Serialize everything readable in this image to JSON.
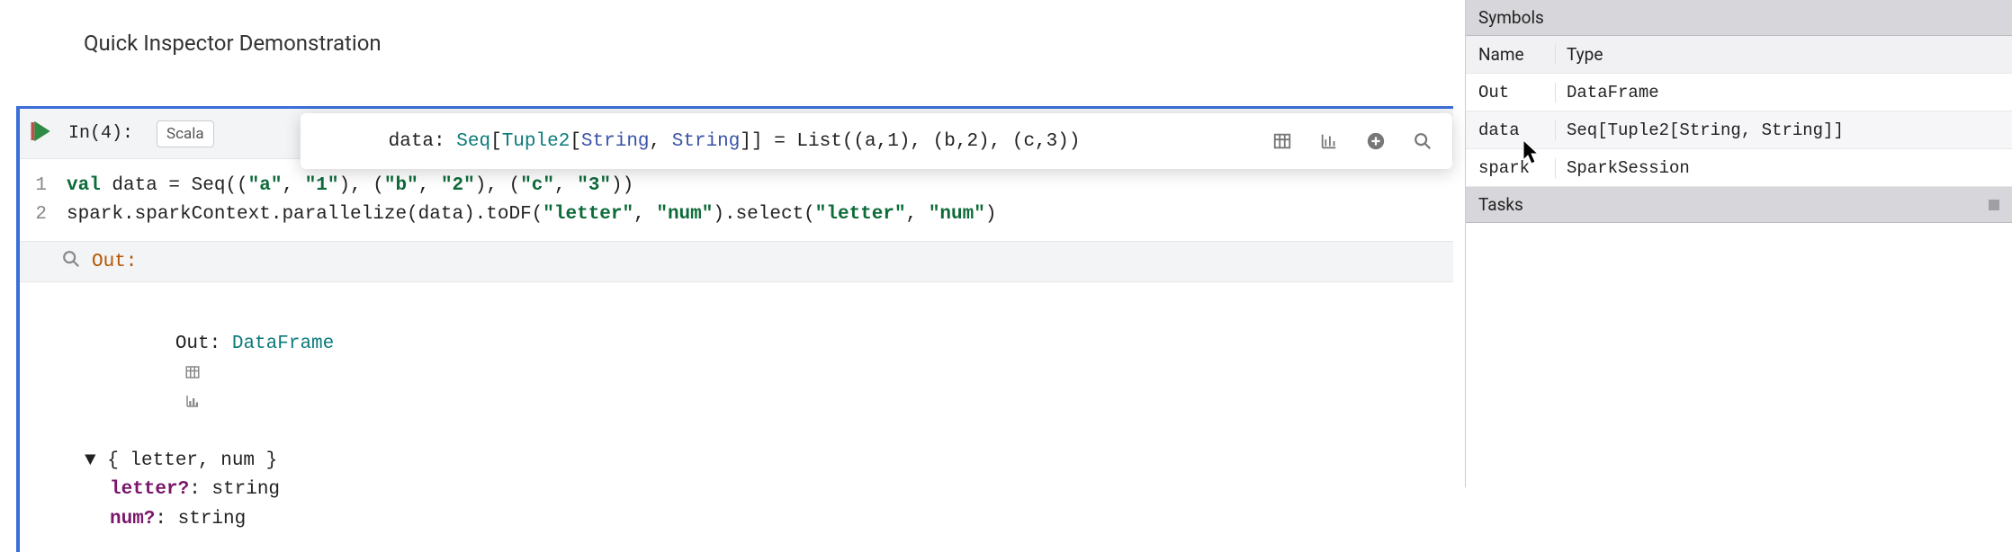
{
  "title": "Quick Inspector Demonstration",
  "cell": {
    "in_label": "In(4):",
    "language": "Scala",
    "lines": [
      {
        "n": "1",
        "tokens": [
          {
            "t": "val ",
            "c": "kw"
          },
          {
            "t": "data = Seq((",
            "c": "plain"
          },
          {
            "t": "\"a\"",
            "c": "str"
          },
          {
            "t": ", ",
            "c": "plain"
          },
          {
            "t": "\"1\"",
            "c": "str"
          },
          {
            "t": "), (",
            "c": "plain"
          },
          {
            "t": "\"b\"",
            "c": "str"
          },
          {
            "t": ", ",
            "c": "plain"
          },
          {
            "t": "\"2\"",
            "c": "str"
          },
          {
            "t": "), (",
            "c": "plain"
          },
          {
            "t": "\"c\"",
            "c": "str"
          },
          {
            "t": ", ",
            "c": "plain"
          },
          {
            "t": "\"3\"",
            "c": "str"
          },
          {
            "t": "))",
            "c": "plain"
          }
        ]
      },
      {
        "n": "2",
        "tokens": [
          {
            "t": "spark.sparkContext.parallelize(data).toDF(",
            "c": "plain"
          },
          {
            "t": "\"letter\"",
            "c": "str"
          },
          {
            "t": ", ",
            "c": "plain"
          },
          {
            "t": "\"num\"",
            "c": "str"
          },
          {
            "t": ").select(",
            "c": "plain"
          },
          {
            "t": "\"letter\"",
            "c": "str"
          },
          {
            "t": ", ",
            "c": "plain"
          },
          {
            "t": "\"num\"",
            "c": "str"
          },
          {
            "t": ")",
            "c": "plain"
          }
        ]
      }
    ]
  },
  "out": {
    "header_label": "Out:",
    "result_prefix": "Out: ",
    "result_type": "DataFrame",
    "schema_header": "▼ { letter, num }",
    "fields": [
      {
        "name": "letter?",
        "type": ": string"
      },
      {
        "name": "num?",
        "type": ": string"
      }
    ]
  },
  "popover": {
    "var": "data",
    "colon": ": ",
    "type_outer": "Seq",
    "lb": "[",
    "type_inner": "Tuple2",
    "lb2": "[",
    "param1": "String",
    "comma": ", ",
    "param2": "String",
    "rb": "]]",
    "eq": " = List((a,1), (b,2), (c,3))"
  },
  "sidebar": {
    "symbols_title": "Symbols",
    "columns": {
      "name": "Name",
      "type": "Type"
    },
    "rows": [
      {
        "name": "Out",
        "type": "DataFrame"
      },
      {
        "name": "data",
        "type": "Seq[Tuple2[String, String]]"
      },
      {
        "name": "spark",
        "type": "SparkSession"
      }
    ],
    "tasks_title": "Tasks"
  }
}
